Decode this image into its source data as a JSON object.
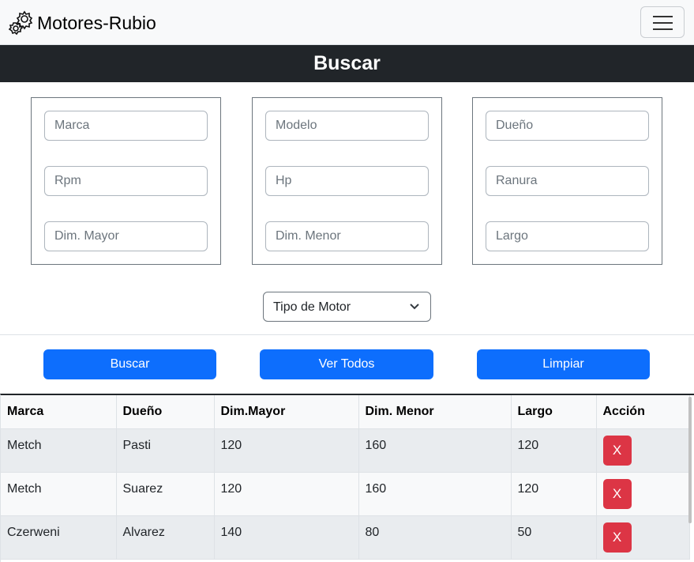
{
  "navbar": {
    "brand": "Motores-Rubio",
    "brand_icon": "gears-icon",
    "toggler_icon": "hamburger-menu-icon"
  },
  "search": {
    "title": "Buscar",
    "groups": [
      {
        "fields": [
          "Marca",
          "Rpm",
          "Dim. Mayor"
        ]
      },
      {
        "fields": [
          "Modelo",
          "Hp",
          "Dim. Menor"
        ]
      },
      {
        "fields": [
          "Dueño",
          "Ranura",
          "Largo"
        ]
      }
    ],
    "motor_type_select": "Tipo de Motor",
    "buttons": {
      "search": "Buscar",
      "view_all": "Ver Todos",
      "clear": "Limpiar"
    }
  },
  "table": {
    "headers": [
      "Marca",
      "Dueño",
      "Dim.Mayor",
      "Dim. Menor",
      "Largo",
      "Acción"
    ],
    "rows": [
      [
        "Metch",
        "Pasti",
        "120",
        "160",
        "120"
      ],
      [
        "Metch",
        "Suarez",
        "120",
        "160",
        "120"
      ],
      [
        "Czerweni",
        "Alvarez",
        "140",
        "80",
        "50"
      ]
    ],
    "delete_label": "X"
  },
  "colors": {
    "primary": "#0d6efd",
    "danger": "#dc3545",
    "dark": "#212529",
    "light": "#f8f9fa"
  }
}
